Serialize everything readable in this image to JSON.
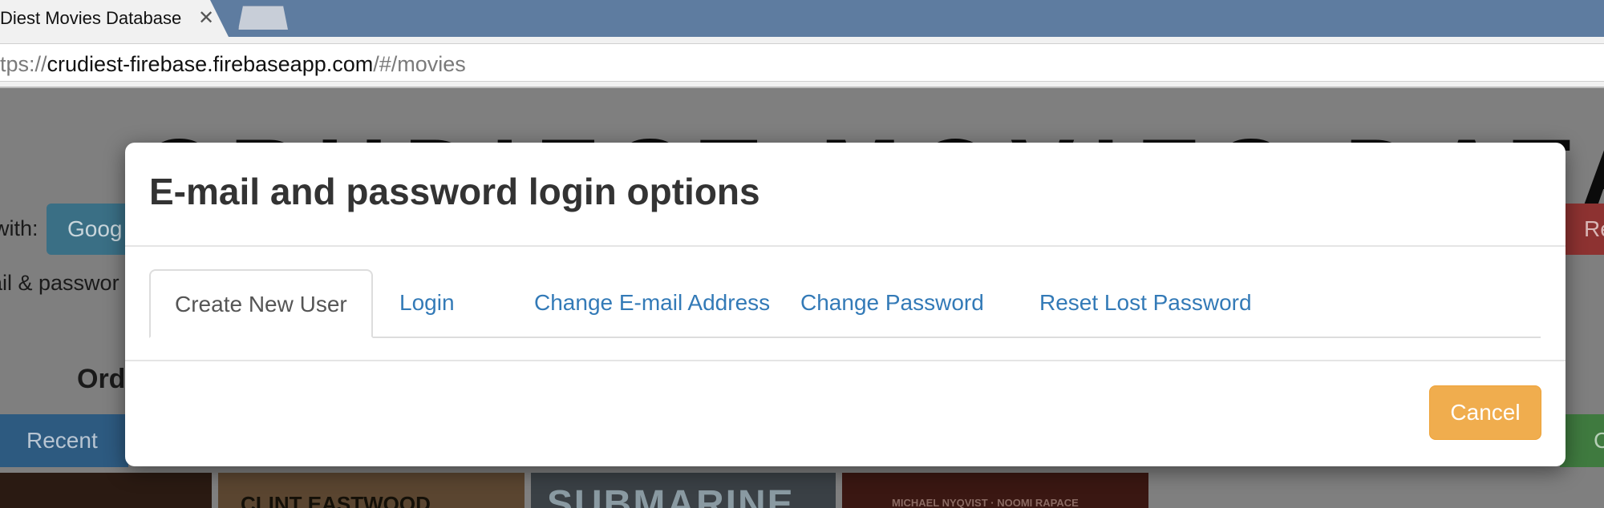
{
  "browser": {
    "tab_title": "Diest Movies Database",
    "close_glyph": "✕",
    "url_scheme": "tps://",
    "url_host": "crudiest-firebase.firebaseapp.com",
    "url_path": "/#/movies"
  },
  "background_page": {
    "title_fragment": "CRUDIEST MOVIES DATABASE",
    "login_with_label": "with:",
    "google_button": "Goog",
    "right_button": "Re",
    "email_password_label": "ail & passwor",
    "order_label": "Ord",
    "recent_button": "Recent",
    "right_green_button": "C",
    "posters": [
      "",
      "CLINT EASTWOOD",
      "SUBMARINE",
      "MICHAEL NYQVIST · NOOMI RAPACE"
    ]
  },
  "modal": {
    "title": "E-mail and password login options",
    "tabs": [
      {
        "label": "Create New User",
        "active": true
      },
      {
        "label": "Login",
        "active": false
      },
      {
        "label": "Change E-mail Address",
        "active": false
      },
      {
        "label": "Change Password",
        "active": false
      },
      {
        "label": "Reset Lost Password",
        "active": false
      }
    ],
    "cancel_label": "Cancel"
  },
  "colors": {
    "link": "#337ab7",
    "cancel_warning": "#f0ad4e",
    "overlay": "#7f7f7f",
    "tabbar": "#5e7ca0"
  }
}
